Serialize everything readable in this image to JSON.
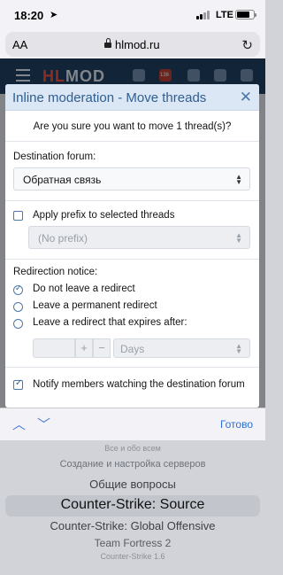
{
  "status_bar": {
    "time": "18:20",
    "network": "LTE"
  },
  "browser": {
    "text_size_button": "AA",
    "host": "hlmod.ru"
  },
  "site_header": {
    "logo_prefix": "HL",
    "logo_suffix": "MOD",
    "notification_count": "136"
  },
  "modal": {
    "title": "Inline moderation - Move threads",
    "confirm_text": "Are you sure you want to move 1 thread(s)?",
    "destination_label": "Destination forum:",
    "destination_value": "Обратная связь",
    "apply_prefix_label": "Apply prefix to selected threads",
    "prefix_value": "(No prefix)",
    "redirection_label": "Redirection notice:",
    "redirect_options": [
      {
        "label": "Do not leave a redirect",
        "checked": true
      },
      {
        "label": "Leave a permanent redirect",
        "checked": false
      },
      {
        "label": "Leave a redirect that expires after:",
        "checked": false
      }
    ],
    "expire_plus": "+",
    "expire_minus": "−",
    "expire_unit": "Days",
    "notify_label": "Notify members watching the destination forum",
    "notify_checked": true
  },
  "keyboard_toolbar": {
    "done_label": "Готово"
  },
  "picker": {
    "options": [
      "Все и обо всем",
      "Создание и настройка серверов",
      "Общие вопросы",
      "Counter-Strike: Source",
      "Counter-Strike: Global Offensive",
      "Team Fortress 2",
      "Counter-Strike 1.6"
    ],
    "selected_index": 3
  },
  "colors": {
    "accent": "#2f5e91",
    "header_bg": "#1e3a5a",
    "logo_red": "#e14a3c",
    "ios_blue": "#2f6fd6"
  }
}
